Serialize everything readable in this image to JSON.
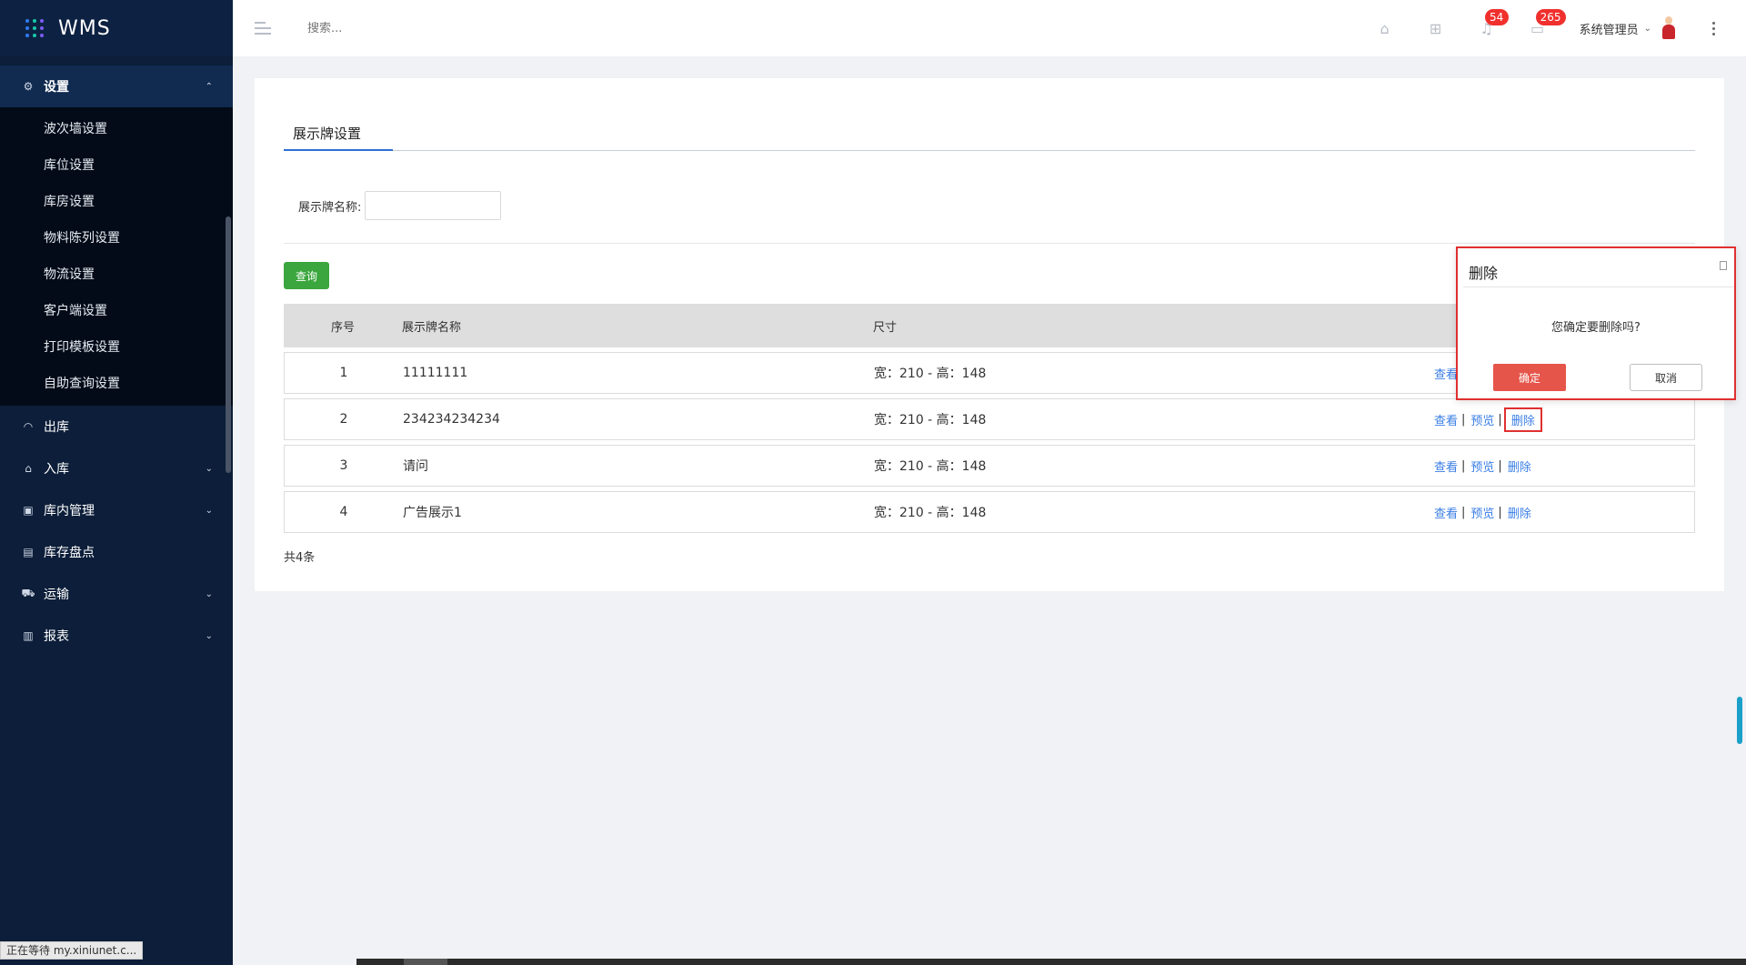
{
  "app": {
    "title": "WMS"
  },
  "sidebar": {
    "group": {
      "label": "设置",
      "icon": "gear-icon"
    },
    "sub_items": [
      "波次墙设置",
      "库位设置",
      "库房设置",
      "物料陈列设置",
      "物流设置",
      "客户端设置",
      "打印模板设置",
      "自助查询设置"
    ],
    "items": [
      {
        "label": "出库",
        "icon": "headset-icon",
        "expandable": false
      },
      {
        "label": "入库",
        "icon": "home-icon",
        "expandable": true
      },
      {
        "label": "库内管理",
        "icon": "box-icon",
        "expandable": true
      },
      {
        "label": "库存盘点",
        "icon": "clipboard-icon",
        "expandable": false
      },
      {
        "label": "运输",
        "icon": "truck-icon",
        "expandable": true
      },
      {
        "label": "报表",
        "icon": "bar-chart-icon",
        "expandable": true
      }
    ]
  },
  "topbar": {
    "search_placeholder": "搜索...",
    "notifications_count": "54",
    "messages_count": "265",
    "user_name": "系统管理员"
  },
  "page": {
    "tab_label": "展示牌设置",
    "filter_label": "展示牌名称:",
    "filter_value": "",
    "query_button": "查询",
    "table": {
      "headers": [
        "序号",
        "展示牌名称",
        "尺寸"
      ],
      "rows": [
        {
          "index": "1",
          "name": "11111111",
          "size": "宽：210 - 高：148"
        },
        {
          "index": "2",
          "name": "234234234234",
          "size": "宽：210 - 高：148"
        },
        {
          "index": "3",
          "name": "请问",
          "size": "宽：210 - 高：148"
        },
        {
          "index": "4",
          "name": "广告展示1",
          "size": "宽：210 - 高：148"
        }
      ],
      "ops": {
        "view": "查看",
        "preview": "预览",
        "delete": "删除",
        "separator": "|"
      }
    },
    "total": "共4条"
  },
  "popconfirm": {
    "title": "删除",
    "message": "您确定要删除吗?",
    "ok": "确定",
    "cancel": "取消"
  },
  "status_bar": "正在等待 my.xiniunet.c..."
}
